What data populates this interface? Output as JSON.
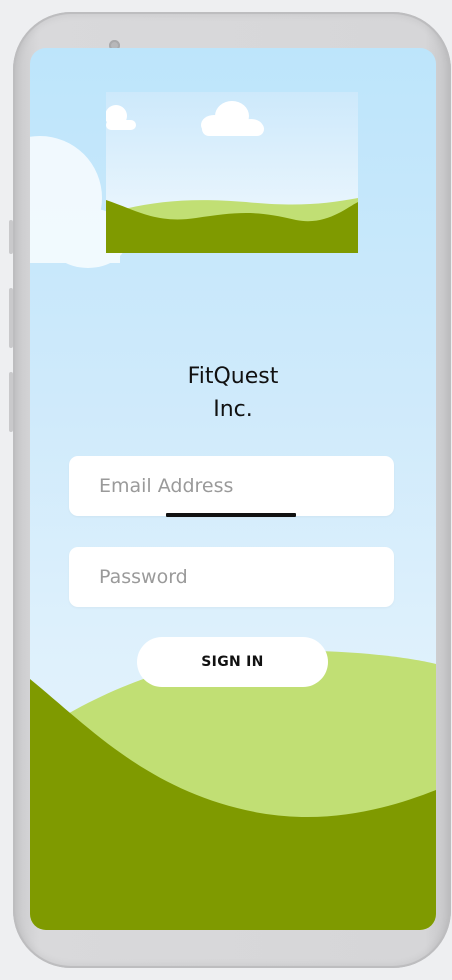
{
  "app": {
    "title_line1": "FitQuest",
    "title_line2": "Inc."
  },
  "login": {
    "email_placeholder": "Email Address",
    "email_value": "",
    "password_placeholder": "Password",
    "password_value": "",
    "signin_label": "SIGN IN"
  },
  "colors": {
    "sky_top": "#bde5fb",
    "sky_bottom": "#e6f3fb",
    "hill_light": "#c1df74",
    "hill_dark": "#7f9a00",
    "card_white": "#ffffff",
    "text_dark": "#111111",
    "placeholder_grey": "#9a9a9a"
  },
  "icons": {
    "hero_image": "landscape-illustration",
    "cloud": "cloud-icon"
  }
}
